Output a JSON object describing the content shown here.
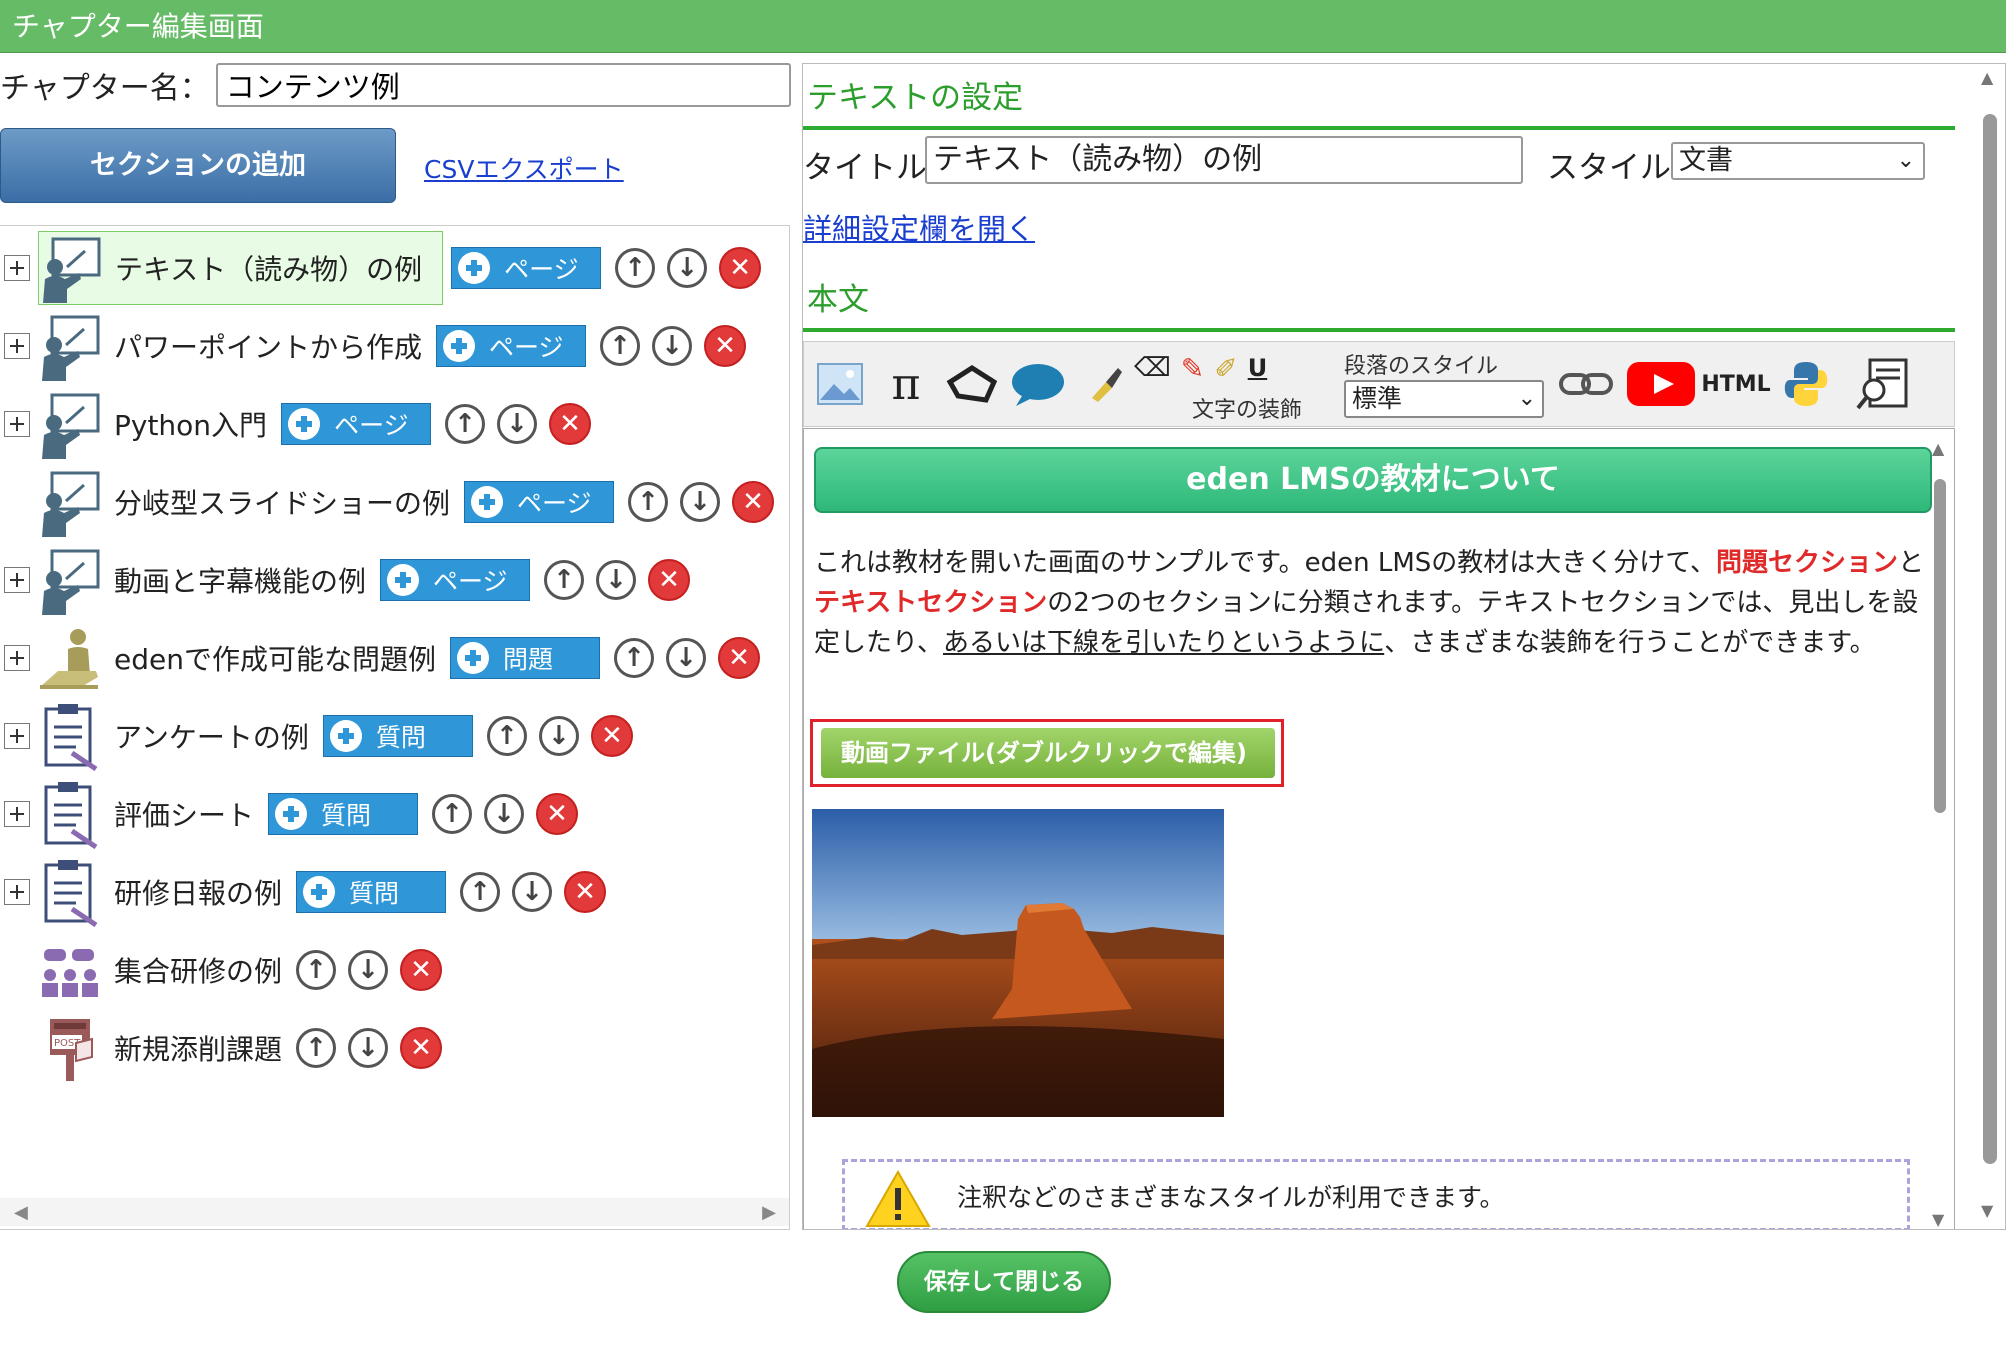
{
  "window": {
    "title": "チャプター編集画面"
  },
  "chapter": {
    "label": "チャプター名：",
    "value": "コンテンツ例"
  },
  "left": {
    "add_section_label": "セクションの追加",
    "csv_export_label": "CSVエクスポート",
    "items": [
      {
        "label": "テキスト（読み物）の例",
        "icon": "presentation-icon",
        "add_label": "ページ",
        "expandable": true,
        "selected": true
      },
      {
        "label": "パワーポイントから作成",
        "icon": "presentation-icon",
        "add_label": "ページ",
        "expandable": true
      },
      {
        "label": "Python入門",
        "icon": "presentation-icon",
        "add_label": "ページ",
        "expandable": true
      },
      {
        "label": "分岐型スライドショーの例",
        "icon": "presentation-icon",
        "add_label": "ページ",
        "expandable": false
      },
      {
        "label": "動画と字幕機能の例",
        "icon": "presentation-icon",
        "add_label": "ページ",
        "expandable": true
      },
      {
        "label": "edenで作成可能な問題例",
        "icon": "exam-icon",
        "add_label": "問題",
        "expandable": true
      },
      {
        "label": "アンケートの例",
        "icon": "clipboard-icon",
        "add_label": "質問",
        "expandable": true
      },
      {
        "label": "評価シート",
        "icon": "clipboard-icon",
        "add_label": "質問",
        "expandable": true
      },
      {
        "label": "研修日報の例",
        "icon": "clipboard-icon",
        "add_label": "質問",
        "expandable": true
      },
      {
        "label": "集合研修の例",
        "icon": "group-icon",
        "add_label": "",
        "expandable": false
      },
      {
        "label": "新規添削課題",
        "icon": "postbox-icon",
        "add_label": "",
        "expandable": false
      }
    ]
  },
  "right": {
    "settings_heading": "テキストの設定",
    "title_label": "タイトル:",
    "title_value": "テキスト（読み物）の例",
    "style_label": "スタイル:",
    "style_value": "文書",
    "detail_link": "詳細設定欄を開く",
    "body_heading": "本文",
    "toolbar": {
      "decoration_label": "文字の装飾",
      "paragraph_label": "段落のスタイル",
      "paragraph_value": "標準",
      "html_label": "HTML",
      "icons": [
        "image-icon",
        "pi-icon",
        "shape-icon",
        "speech-bubble-icon",
        "eraser-brush-icon",
        "underline-icon",
        "link-icon",
        "youtube-icon",
        "html-icon",
        "python-icon",
        "preview-icon"
      ]
    },
    "content": {
      "banner": "eden LMSの教材について",
      "p1_a": "これは教材を開いた画面のサンプルです。eden LMSの教材は大きく分けて、",
      "p1_red1": "問題セクション",
      "p1_b": "と",
      "p1_red2": "テキストセクション",
      "p1_c": "の2つのセクションに分類されます。テキストセクションでは、見出しを設定したり、",
      "p1_underline": "あるいは下線を引いたりというように",
      "p1_d": "、さまざまな装飾を行うことができます。",
      "video_button": "動画ファイル(ダブルクリックで編集)",
      "note": "注釈などのさまざまなスタイルが利用できます。"
    }
  },
  "footer": {
    "save_close": "保存して閉じる"
  },
  "colors": {
    "titlebar": "#66bb66",
    "accent_green": "#2eaa2e",
    "add_button": "#2f97d8",
    "delete": "#e23a3a"
  }
}
